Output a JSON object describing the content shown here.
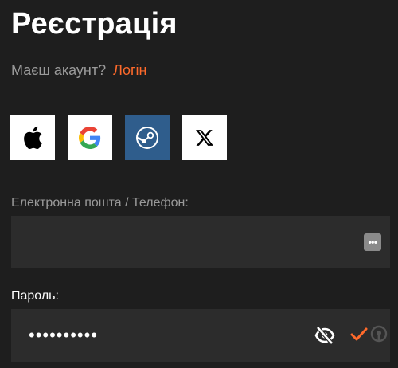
{
  "header": {
    "title": "Реєстрація"
  },
  "account": {
    "prompt": "Маєш акаунт?",
    "login_link": "Логін"
  },
  "social": {
    "buttons": [
      {
        "name": "apple",
        "icon": "apple-icon"
      },
      {
        "name": "google",
        "icon": "google-icon"
      },
      {
        "name": "steam",
        "icon": "steam-icon"
      },
      {
        "name": "x",
        "icon": "x-icon"
      }
    ]
  },
  "form": {
    "email": {
      "label": "Електронна пошта / Телефон:",
      "value": "",
      "placeholder": ""
    },
    "password": {
      "label": "Пароль:",
      "masked_value": "••••••••••"
    }
  },
  "colors": {
    "background": "#1e1e1e",
    "field_bg": "#2c2c2c",
    "accent": "#ff6a2b",
    "steam_bg": "#2f5d8c"
  }
}
